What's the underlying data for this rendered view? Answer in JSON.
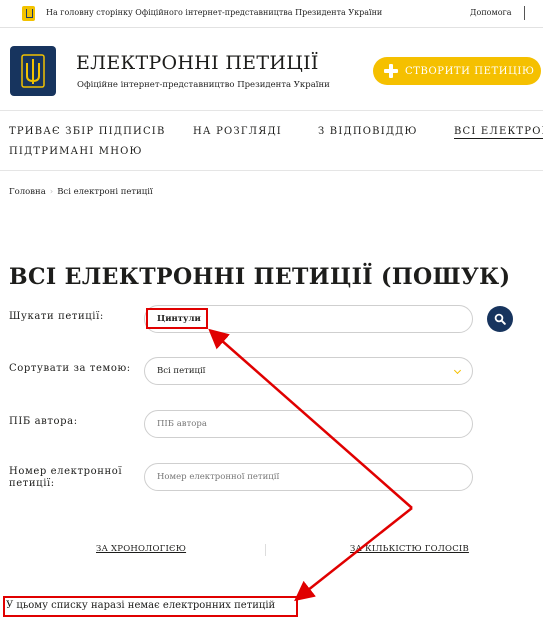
{
  "topbar": {
    "home_link": "На головну сторінку Офіційного інтернет-представництва Президента України",
    "help": "Допомога"
  },
  "header": {
    "title": "ЕЛЕКТРОННІ ПЕТИЦІЇ",
    "subtitle": "Офіційне інтернет-представництво Президента України",
    "create_button": "СТВОРИТИ ПЕТИЦІЮ"
  },
  "tabs": [
    {
      "label": "ТРИВАЄ ЗБІР ПІДПИСІВ"
    },
    {
      "label": "НА РОЗГЛЯДІ"
    },
    {
      "label": "З ВІДПОВІДДЮ"
    },
    {
      "label": "ВСІ ЕЛЕКТРОННІ"
    },
    {
      "label": "ПІДТРИМАНІ МНОЮ"
    }
  ],
  "breadcrumb": {
    "home": "Головна",
    "separator": "›",
    "current": "Всі електроні петиції"
  },
  "page": {
    "title": "ВСІ ЕЛЕКТРОННІ ПЕТИЦІЇ (ПОШУК)"
  },
  "form": {
    "search": {
      "label": "Шукати петиції:",
      "value": "Цинтули"
    },
    "topic": {
      "label": "Сортувати за темою:",
      "value": "Всі петиції"
    },
    "author": {
      "label": "ПІБ автора:",
      "placeholder": "ПІБ автора"
    },
    "number": {
      "label": "Номер електронної петиції:",
      "placeholder": "Номер електронної петиції"
    }
  },
  "sort": {
    "chronology": "ЗА ХРОНОЛОГІЄЮ",
    "votes": "ЗА КІЛЬКІСТЮ ГОЛОСІВ"
  },
  "results": {
    "empty_message": "У цьому списку наразі немає електронних петицій"
  },
  "colors": {
    "accent": "#f5c000",
    "brand_navy": "#17345e",
    "annotation": "#e00000"
  },
  "icons": [
    "trident-icon",
    "plus-icon",
    "search-icon",
    "chevron-down-icon"
  ]
}
